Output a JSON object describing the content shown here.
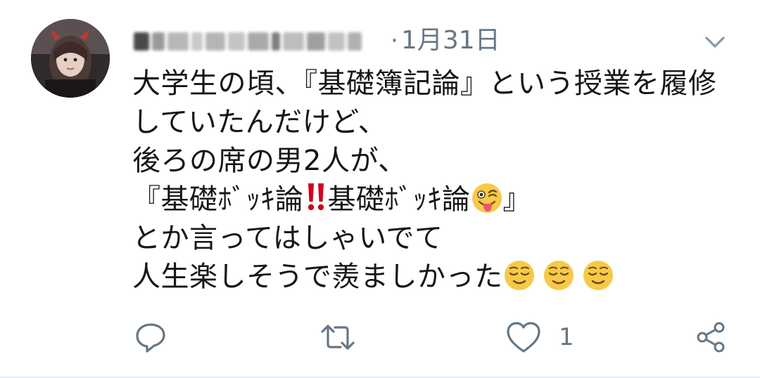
{
  "tweet": {
    "date": "1月31日",
    "separator": "·",
    "lines": [
      {
        "text": "大学生の頃、『基礎簿記論』という授業を履修"
      },
      {
        "text": "していたんだけど、"
      },
      {
        "text": "後ろの席の男2人が、"
      },
      {
        "seg1": "『基礎ﾎﾞｯｷ論",
        "seg2": "基礎ﾎﾞｯｷ論",
        "seg3": "』"
      },
      {
        "text": "とか言ってはしゃいでて"
      },
      {
        "text": "人生楽しそうで羨ましかった"
      }
    ],
    "emojis": {
      "bangbang": "double-exclamation",
      "wink_tongue": "winking-face-with-tongue",
      "relieved": "relieved-face"
    },
    "actions": {
      "reply_icon": "reply-icon",
      "retweet_icon": "retweet-icon",
      "like_icon": "heart-icon",
      "like_count": "1",
      "share_icon": "share-icon"
    },
    "colors": {
      "text": "#14171a",
      "muted": "#657786",
      "icon": "#657786",
      "emoji_yellow": "#f7c948",
      "bangbang_red": "#d0021b"
    }
  }
}
